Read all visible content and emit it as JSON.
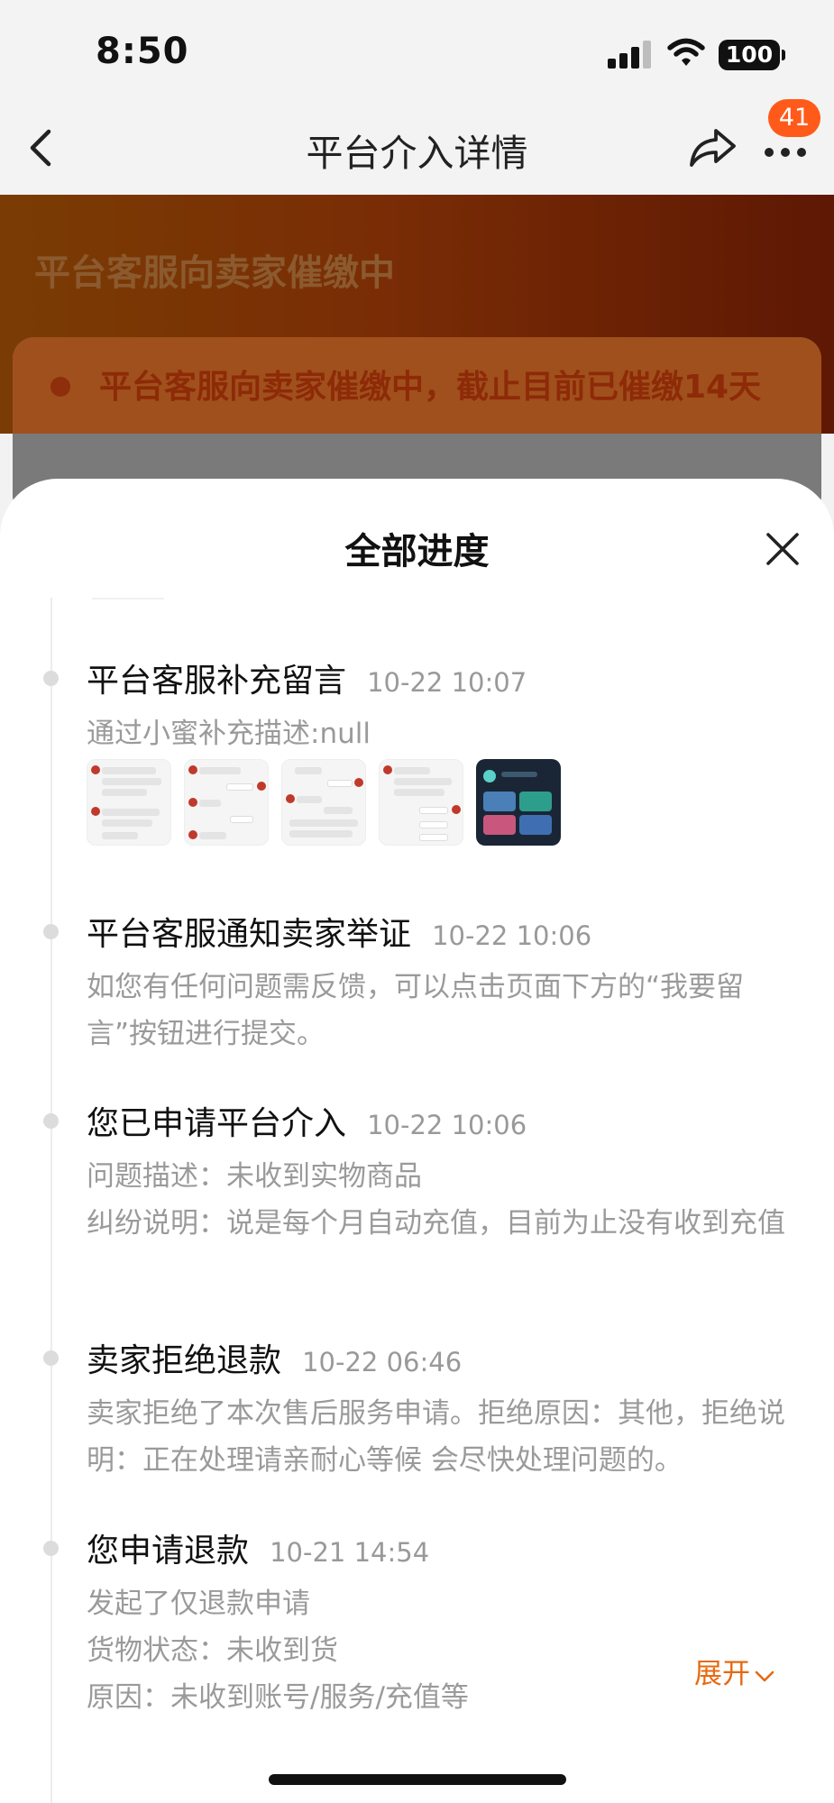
{
  "status_bar": {
    "time": "8:50",
    "battery": "100"
  },
  "nav": {
    "title": "平台介入详情",
    "badge_count": "41"
  },
  "background": {
    "header_title": "平台客服向卖家催缴中",
    "card_text": "平台客服向卖家催缴中，截止目前已催缴14天"
  },
  "sheet": {
    "title": "全部进度",
    "events": [
      {
        "title": "平台客服补充留言",
        "time": "10-22 10:07",
        "lines": [
          "通过小蜜补充描述:null"
        ],
        "image_count": 5
      },
      {
        "title": "平台客服通知卖家举证",
        "time": "10-22 10:06",
        "lines": [
          "如您有任何问题需反馈，可以点击页面下方的“我要留言”按钮进行提交。"
        ]
      },
      {
        "title": "您已申请平台介入",
        "time": "10-22 10:06",
        "lines": [
          "问题描述：未收到实物商品",
          "纠纷说明：说是每个月自动充值，目前为止没有收到充值"
        ]
      },
      {
        "title": "卖家拒绝退款",
        "time": "10-22 06:46",
        "lines": [
          "卖家拒绝了本次售后服务申请。拒绝原因：其他，拒绝说明：正在处理请亲耐心等候 会尽快处理问题的。"
        ]
      },
      {
        "title": "您申请退款",
        "time": "10-21 14:54",
        "lines": [
          "发起了仅退款申请",
          "货物状态：未收到货",
          "原因：未收到账号/服务/充值等"
        ]
      }
    ],
    "expand_label": "展开"
  },
  "colors": {
    "accent_orange": "#e56a12",
    "badge": "#ff5a1a",
    "hero_brown": "#7a3c04"
  },
  "icons": [
    "back-icon",
    "share-icon",
    "more-icon",
    "close-icon",
    "chevron-down-icon",
    "signal-icon",
    "wifi-icon",
    "battery-icon"
  ]
}
